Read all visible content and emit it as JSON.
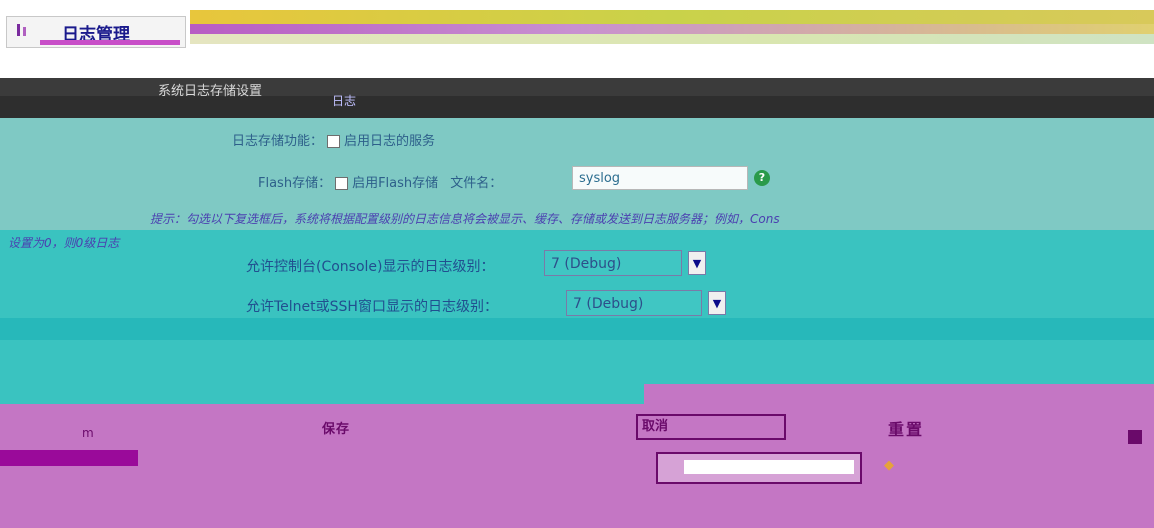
{
  "window": {
    "title": "日志管理"
  },
  "section": {
    "title": "系统日志存储设置",
    "subtitle": "日志",
    "enable_label": "日志存储功能：",
    "enable_check": "启用日志的服务",
    "flash_label": "Flash存储：",
    "flash_check": "启用Flash存储",
    "filename_label": "文件名：",
    "filename_value": "syslog",
    "warning": "提示：勾选以下复选框后，系统将根据配置级别的日志信息将会被显示、缓存、存储或发送到日志服务器；例如，Cons",
    "warning_tail": "设置为0，则0级日志"
  },
  "console": {
    "label": "允许控制台(Console)显示的日志级别：",
    "value": "7 (Debug)"
  },
  "telnet": {
    "label": "允许Telnet或SSH窗口显示的日志级别：",
    "value": "7 (Debug)"
  },
  "buttons": {
    "save": "保存",
    "cancel": "取消",
    "reset": "重置"
  },
  "colors": {
    "accent": "#7fc9c4",
    "teal": "#3ac3c0",
    "magenta": "#c476c4",
    "help": "#2a9a4a"
  },
  "icons": {
    "title": "log-icon",
    "help": "help-icon",
    "dropdown": "chevron-down-icon"
  }
}
